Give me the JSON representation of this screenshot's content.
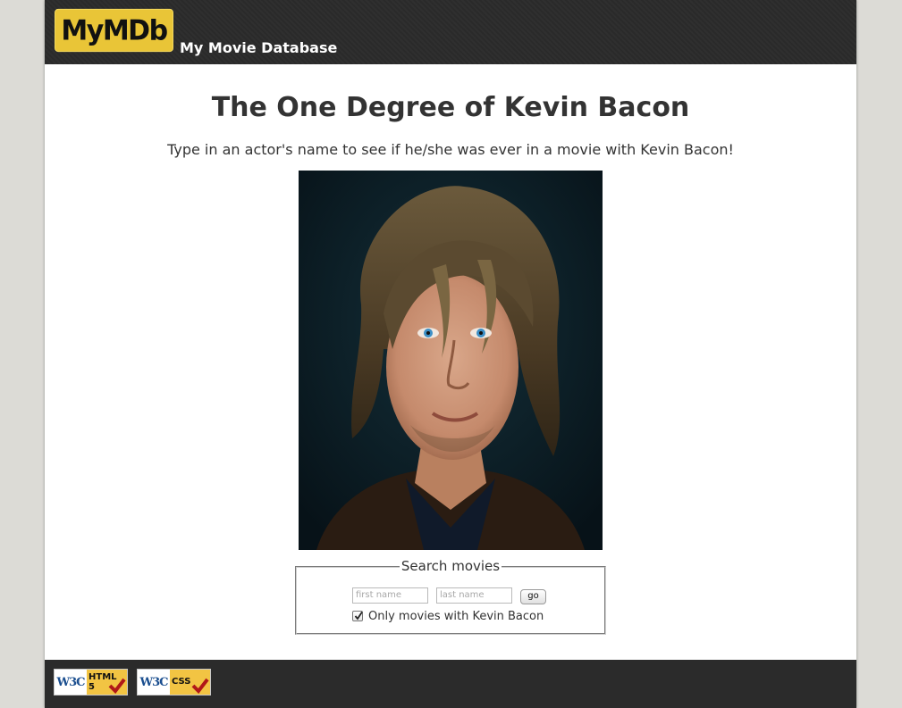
{
  "header": {
    "logo_text": "MyMDb",
    "site_name": "My Movie Database"
  },
  "main": {
    "title": "The One Degree of Kevin Bacon",
    "subtitle": "Type in an actor's name to see if he/she was ever in a movie with Kevin Bacon!"
  },
  "search": {
    "legend": "Search movies",
    "first_name_placeholder": "first name",
    "last_name_placeholder": "last name",
    "go_label": "go",
    "checkbox_label": "Only movies with Kevin Bacon",
    "checkbox_checked": true
  },
  "footer": {
    "badges": [
      {
        "logo": "W3C",
        "label_line1": "HTML",
        "label_line2": "5"
      },
      {
        "logo": "W3C",
        "label_line1": "CSS",
        "label_line2": ""
      }
    ]
  },
  "colors": {
    "banner": "#2b2b2b",
    "logo_yellow": "#e9c537",
    "page_background": "#dcdbd6",
    "badge_yellow": "#f2c443",
    "check_red": "#b01818"
  }
}
